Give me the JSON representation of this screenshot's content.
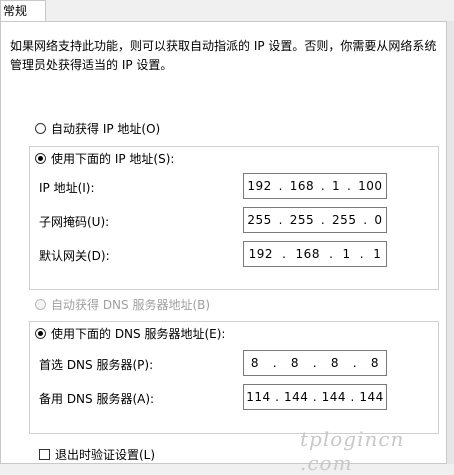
{
  "tab": {
    "label": "常规"
  },
  "description": "如果网络支持此功能，则可以获取自动指派的 IP 设置。否则，你需要从网络系统管理员处获得适当的 IP 设置。",
  "ip_mode": {
    "auto_label": "自动获得 IP 地址(O)",
    "manual_label": "使用下面的 IP 地址(S):",
    "selected": "manual"
  },
  "ip_fields": [
    {
      "label": "IP 地址(I):",
      "octets": [
        "192",
        "168",
        "1",
        "100"
      ]
    },
    {
      "label": "子网掩码(U):",
      "octets": [
        "255",
        "255",
        "255",
        "0"
      ]
    },
    {
      "label": "默认网关(D):",
      "octets": [
        "192",
        "168",
        "1",
        "1"
      ]
    }
  ],
  "dns_mode": {
    "auto_label": "自动获得 DNS 服务器地址(B)",
    "manual_label": "使用下面的 DNS 服务器地址(E):",
    "selected": "manual",
    "auto_disabled": true
  },
  "dns_fields": [
    {
      "label": "首选 DNS 服务器(P):",
      "octets": [
        "8",
        "8",
        "8",
        "8"
      ]
    },
    {
      "label": "备用 DNS 服务器(A):",
      "octets": [
        "114",
        "144",
        "144",
        "144"
      ]
    }
  ],
  "validate_on_exit": {
    "label": "退出时验证设置(L)",
    "checked": false
  },
  "watermark": "tplogincn .com"
}
